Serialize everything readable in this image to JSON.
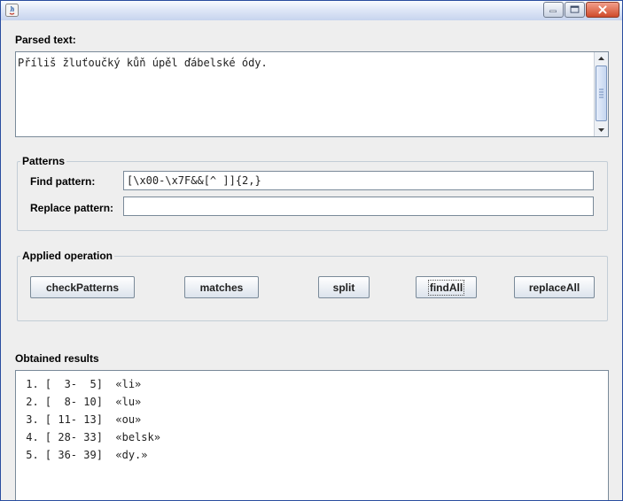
{
  "window": {
    "title": "",
    "controls": {
      "minimize": "minimize-icon",
      "maximize": "maximize-icon",
      "close": "close-icon"
    }
  },
  "parsed": {
    "label": "Parsed text:",
    "text": "Příliš žluťoučký kůň úpěl ďábelské ódy."
  },
  "patterns": {
    "group_title": "Patterns",
    "find_label": "Find pattern:",
    "find_value": "[\\x00-\\x7F&&[^ ]]{2,}",
    "replace_label": "Replace pattern:",
    "replace_value": ""
  },
  "operations": {
    "group_title": "Applied operation",
    "buttons": [
      "checkPatterns",
      "matches",
      "split",
      "findAll",
      "replaceAll"
    ],
    "focused": "findAll"
  },
  "results": {
    "label": "Obtained results",
    "lines": [
      " 1. [  3-  5]  «li»",
      " 2. [  8- 10]  «lu»",
      " 3. [ 11- 13]  «ou»",
      " 4. [ 28- 33]  «belsk»",
      " 5. [ 36- 39]  «dy.»"
    ]
  },
  "colors": {
    "window_bg": "#eeeeee",
    "border_blue": "#2a4d9f",
    "field_border": "#7a8a99",
    "group_border": "#c3cdd6"
  }
}
